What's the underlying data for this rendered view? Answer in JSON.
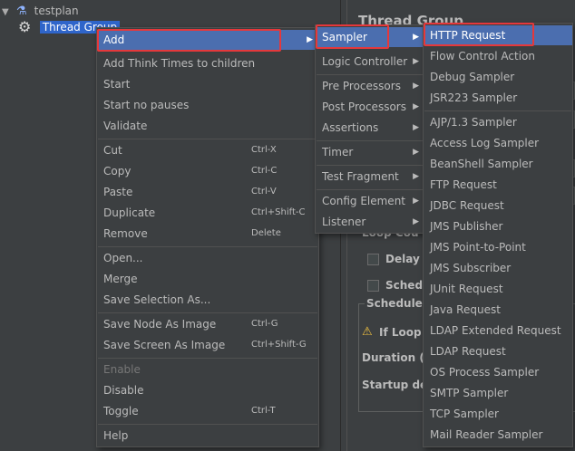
{
  "tree": {
    "root_label": "testplan",
    "child_label": "Thread Group"
  },
  "pane": {
    "title": "Thread Group",
    "loop_count": "Loop Cou",
    "delay": "Delay T",
    "scheduler": "Schedu",
    "group_title": "Scheduler C",
    "warning": "If Loop C",
    "duration": "Duration (se",
    "startup": "Startup dela"
  },
  "context_menu": {
    "add": "Add",
    "add_think_times": "Add Think Times to children",
    "start": "Start",
    "start_no_pauses": "Start no pauses",
    "validate": "Validate",
    "cut": "Cut",
    "cut_shortcut": "Ctrl-X",
    "copy": "Copy",
    "copy_shortcut": "Ctrl-C",
    "paste": "Paste",
    "paste_shortcut": "Ctrl-V",
    "duplicate": "Duplicate",
    "duplicate_shortcut": "Ctrl+Shift-C",
    "remove": "Remove",
    "remove_shortcut": "Delete",
    "open": "Open...",
    "merge": "Merge",
    "save_selection": "Save Selection As...",
    "save_node_image": "Save Node As Image",
    "save_node_image_shortcut": "Ctrl-G",
    "save_screen_image": "Save Screen As Image",
    "save_screen_image_shortcut": "Ctrl+Shift-G",
    "enable": "Enable",
    "disable": "Disable",
    "toggle": "Toggle",
    "toggle_shortcut": "Ctrl-T",
    "help": "Help"
  },
  "add_menu": {
    "sampler": "Sampler",
    "logic_controller": "Logic Controller",
    "pre_processors": "Pre Processors",
    "post_processors": "Post Processors",
    "assertions": "Assertions",
    "timer": "Timer",
    "test_fragment": "Test Fragment",
    "config_element": "Config Element",
    "listener": "Listener"
  },
  "sampler_menu": {
    "items": [
      "HTTP Request",
      "Flow Control Action",
      "Debug Sampler",
      "JSR223 Sampler",
      "AJP/1.3 Sampler",
      "Access Log Sampler",
      "BeanShell Sampler",
      "FTP Request",
      "JDBC Request",
      "JMS Publisher",
      "JMS Point-to-Point",
      "JMS Subscriber",
      "JUnit Request",
      "Java Request",
      "LDAP Extended Request",
      "LDAP Request",
      "OS Process Sampler",
      "SMTP Sampler",
      "TCP Sampler",
      "Mail Reader Sampler"
    ]
  },
  "colors": {
    "menu_bg": "#3c3f41",
    "highlight": "#4b6eaf",
    "annotation_red": "#e5383b",
    "selection": "#2f65ca"
  }
}
